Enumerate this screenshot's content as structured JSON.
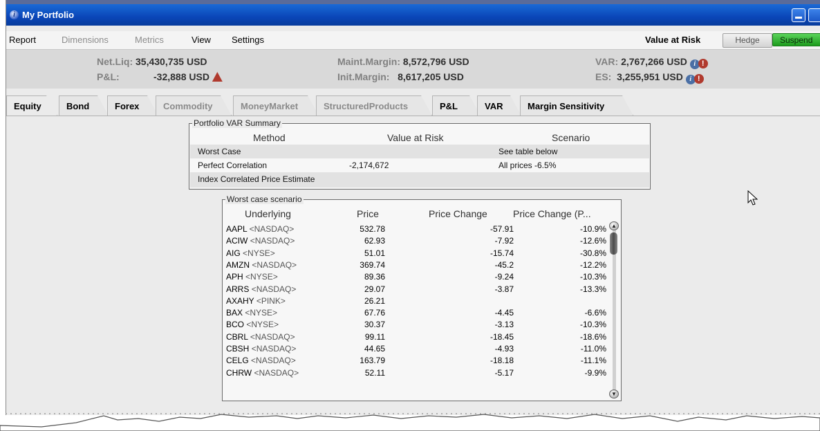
{
  "window": {
    "title": "My Portfolio"
  },
  "menubar": {
    "items": [
      "Report",
      "Dimensions",
      "Metrics",
      "View",
      "Settings"
    ],
    "value_at_risk_label": "Value at Risk",
    "hedge_label": "Hedge",
    "suspend_label": "Suspend"
  },
  "summary": {
    "net_liq_label": "Net.Liq:",
    "net_liq_value": "35,430,735 USD",
    "pnl_label": "P&L:",
    "pnl_value": "-32,888 USD",
    "maint_margin_label": "Maint.Margin:",
    "maint_margin_value": "8,572,796 USD",
    "init_margin_label": "Init.Margin:",
    "init_margin_value": "8,617,205 USD",
    "var_label": "VAR:",
    "var_value": "2,767,266 USD",
    "es_label": "ES:",
    "es_value": "3,255,951 USD"
  },
  "tabs": [
    "Equity",
    "Bond",
    "Forex",
    "Commodity",
    "MoneyMarket",
    "StructuredProducts",
    "P&L",
    "VAR",
    "Margin Sensitivity"
  ],
  "var_summary": {
    "legend": "Portfolio VAR Summary",
    "headers": {
      "method": "Method",
      "value": "Value at Risk",
      "scenario": "Scenario"
    },
    "rows": [
      {
        "method": "Worst Case",
        "value": "",
        "scenario": "See table below"
      },
      {
        "method": "Perfect Correlation",
        "value": "-2,174,672",
        "scenario": "All prices  -6.5%"
      },
      {
        "method": "Index Correlated Price Estimate",
        "value": "",
        "scenario": ""
      }
    ]
  },
  "worst_case": {
    "legend": "Worst case scenario",
    "headers": {
      "underlying": "Underlying",
      "price": "Price",
      "change": "Price Change",
      "pct": "Price Change (P..."
    },
    "rows": [
      {
        "sym": "AAPL",
        "ex": "<NASDAQ>",
        "price": "532.78",
        "change": "-57.91",
        "pct": "-10.9%"
      },
      {
        "sym": "ACIW",
        "ex": "<NASDAQ>",
        "price": "62.93",
        "change": "-7.92",
        "pct": "-12.6%"
      },
      {
        "sym": "AIG",
        "ex": "<NYSE>",
        "price": "51.01",
        "change": "-15.74",
        "pct": "-30.8%"
      },
      {
        "sym": "AMZN",
        "ex": "<NASDAQ>",
        "price": "369.74",
        "change": "-45.2",
        "pct": "-12.2%"
      },
      {
        "sym": "APH",
        "ex": "<NYSE>",
        "price": "89.36",
        "change": "-9.24",
        "pct": "-10.3%"
      },
      {
        "sym": "ARRS",
        "ex": "<NASDAQ>",
        "price": "29.07",
        "change": "-3.87",
        "pct": "-13.3%"
      },
      {
        "sym": "AXAHY",
        "ex": "<PINK>",
        "price": "26.21",
        "change": "",
        "pct": ""
      },
      {
        "sym": "BAX",
        "ex": "<NYSE>",
        "price": "67.76",
        "change": "-4.45",
        "pct": "-6.6%"
      },
      {
        "sym": "BCO",
        "ex": "<NYSE>",
        "price": "30.37",
        "change": "-3.13",
        "pct": "-10.3%"
      },
      {
        "sym": "CBRL",
        "ex": "<NASDAQ>",
        "price": "99.11",
        "change": "-18.45",
        "pct": "-18.6%"
      },
      {
        "sym": "CBSH",
        "ex": "<NASDAQ>",
        "price": "44.65",
        "change": "-4.93",
        "pct": "-11.0%"
      },
      {
        "sym": "CELG",
        "ex": "<NASDAQ>",
        "price": "163.79",
        "change": "-18.18",
        "pct": "-11.1%"
      },
      {
        "sym": "CHRW",
        "ex": "<NASDAQ>",
        "price": "52.11",
        "change": "-5.17",
        "pct": "-9.9%"
      }
    ]
  }
}
